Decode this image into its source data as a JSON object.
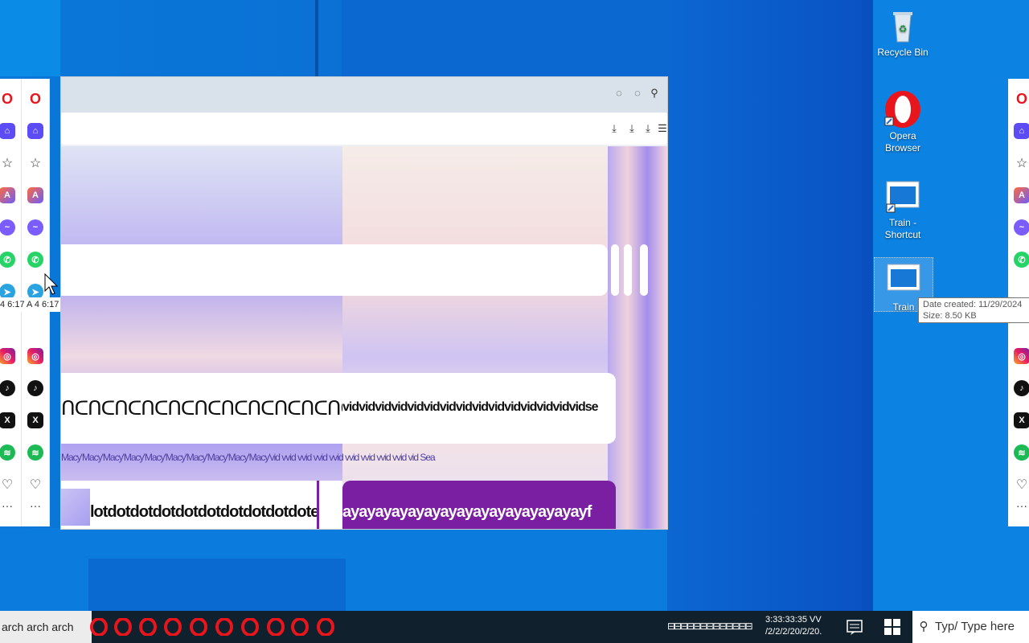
{
  "desktop": {
    "icons": [
      {
        "label": "Recycle Bin"
      },
      {
        "label": "Opera Browser"
      },
      {
        "label": "Train - Shortcut"
      },
      {
        "label": "Train"
      }
    ],
    "tooltip": {
      "date_created": "Date created: 11/29/2024",
      "size": "Size: 8.50 KB"
    }
  },
  "sidebar": {
    "time_label": "4 6:17 A",
    "items": [
      "opera-logo-icon",
      "home-icon",
      "star-icon",
      "aria-icon",
      "messenger-icon",
      "whatsapp-icon",
      "telegram-icon",
      "instagram-icon",
      "tiktok-icon",
      "x-icon",
      "spotify-icon",
      "heart-icon",
      "more-icon"
    ]
  },
  "browser": {
    "glitch_row_1": "ᑎᑕᑎᑕᑎᑕᑎᑕᑎᑕᑎᑕᑎᑕᑎᑕᑎᑕᑎᑕᑎᑕᑎᑕᑎᑕᑎᑕᑎᑕᑎ",
    "glitch_row_2": "vidvidvidvidvidvidvidvidvidvidvidvidvidvidvidse",
    "glitch_row_3": "Macy'Macy'Macy'Macy'Macy'Macy'Macy'Macy'Macy'Macy'vid vvid vvid vvid vvid vvid vvid vvid vvid vid Sea",
    "glitch_row_4": "lotdotdotdotdotdotdotdotdotdote",
    "glitch_row_5": "ayayayayayayayayayayayayayayayf"
  },
  "taskbar": {
    "search_text": "arch arch arch",
    "clock_time": "3:33:33:35 VV",
    "clock_date": "/2/2/2/20/2/20.",
    "search_box_text": "Typ/  Type here"
  },
  "colors": {
    "accent": "#5b4cf5",
    "opera_red": "#e8161c",
    "desktop_blue": "#0a72d6",
    "taskbar": "#10202c"
  }
}
